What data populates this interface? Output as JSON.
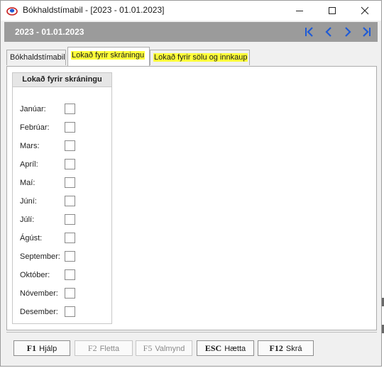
{
  "window": {
    "title": "Bókhaldstímabil - [2023 - 01.01.2023]",
    "app_icon": "app-logo-icon",
    "controls": [
      "minimize-icon",
      "maximize-icon",
      "close-icon"
    ]
  },
  "header": {
    "title": "2023 - 01.01.2023",
    "nav": [
      "first-record-icon",
      "previous-record-icon",
      "next-record-icon",
      "last-record-icon"
    ],
    "nav_color": "#1f5bd6",
    "band_color": "#9b9b9b"
  },
  "tabs": [
    {
      "label": "Bókhaldstímabil"
    },
    {
      "label": "Lokað fyrir skráningu",
      "highlight": "#ffff3a"
    },
    {
      "label": "Lokað fyrir sölu og innkaup",
      "highlight": "#ffff3a"
    }
  ],
  "group": {
    "title": "Lokað fyrir skráningu",
    "months": [
      {
        "label": "Janúar:",
        "checked": false
      },
      {
        "label": "Febrúar:",
        "checked": false
      },
      {
        "label": "Mars:",
        "checked": false
      },
      {
        "label": "Apríl:",
        "checked": false
      },
      {
        "label": "Maí:",
        "checked": false
      },
      {
        "label": "Júní:",
        "checked": false
      },
      {
        "label": "Júlí:",
        "checked": false
      },
      {
        "label": "Ágúst:",
        "checked": false
      },
      {
        "label": "September:",
        "checked": false
      },
      {
        "label": "Október:",
        "checked": false
      },
      {
        "label": "Nóvember:",
        "checked": false
      },
      {
        "label": "Desember:",
        "checked": false
      }
    ]
  },
  "footer": {
    "buttons": [
      {
        "key": "F1",
        "label": "Hjálp",
        "enabled": true
      },
      {
        "key": "F2",
        "label": "Fletta",
        "enabled": false
      },
      {
        "key": "F5",
        "label": "Valmynd",
        "enabled": false
      },
      {
        "key": "ESC",
        "label": "Hætta",
        "enabled": true
      },
      {
        "key": "F12",
        "label": "Skrá",
        "enabled": true
      }
    ]
  }
}
